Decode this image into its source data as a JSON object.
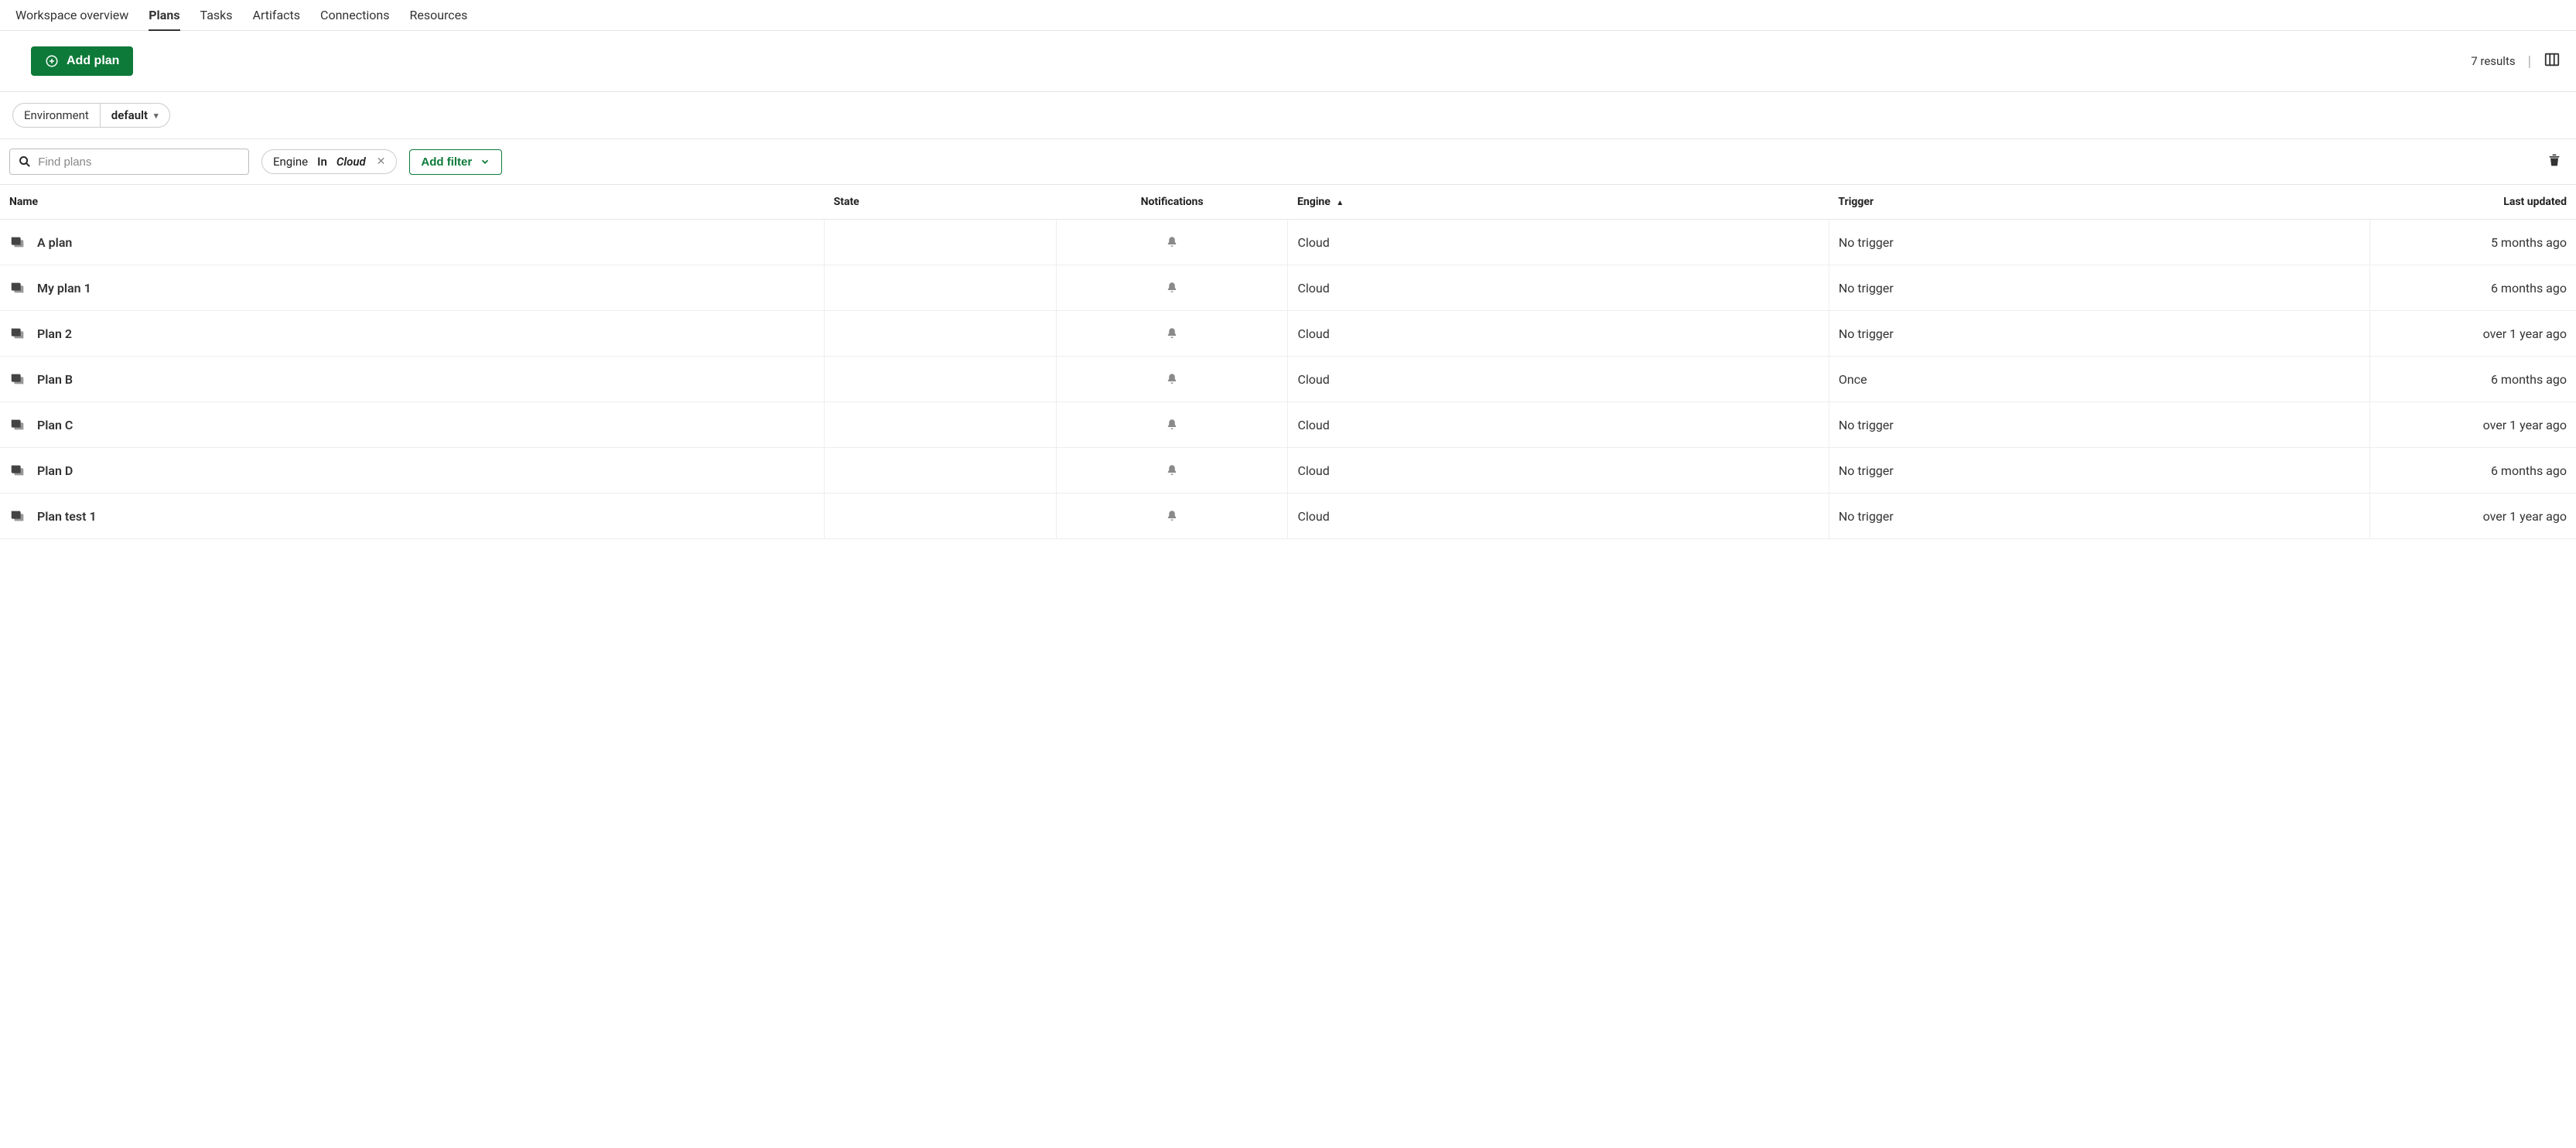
{
  "nav": {
    "items": [
      {
        "label": "Workspace overview",
        "active": false
      },
      {
        "label": "Plans",
        "active": true
      },
      {
        "label": "Tasks",
        "active": false
      },
      {
        "label": "Artifacts",
        "active": false
      },
      {
        "label": "Connections",
        "active": false
      },
      {
        "label": "Resources",
        "active": false
      }
    ]
  },
  "toolbar": {
    "add_plan_label": "Add plan",
    "results_label": "7 results"
  },
  "environment": {
    "label": "Environment",
    "value": "default"
  },
  "search": {
    "placeholder": "Find plans"
  },
  "filters": {
    "engine": {
      "field": "Engine",
      "op": "In",
      "value": "Cloud"
    },
    "add_filter_label": "Add filter"
  },
  "table": {
    "columns": {
      "name": "Name",
      "state": "State",
      "notifications": "Notifications",
      "engine": "Engine",
      "trigger": "Trigger",
      "last_updated": "Last updated"
    },
    "sort": {
      "column": "engine",
      "dir": "asc"
    },
    "rows": [
      {
        "name": "A plan",
        "state": "",
        "engine": "Cloud",
        "trigger": "No trigger",
        "last_updated": "5 months ago"
      },
      {
        "name": "My plan 1",
        "state": "",
        "engine": "Cloud",
        "trigger": "No trigger",
        "last_updated": "6 months ago"
      },
      {
        "name": "Plan 2",
        "state": "",
        "engine": "Cloud",
        "trigger": "No trigger",
        "last_updated": "over 1 year ago"
      },
      {
        "name": "Plan B",
        "state": "",
        "engine": "Cloud",
        "trigger": "Once",
        "last_updated": "6 months ago"
      },
      {
        "name": "Plan C",
        "state": "",
        "engine": "Cloud",
        "trigger": "No trigger",
        "last_updated": "over 1 year ago"
      },
      {
        "name": "Plan D",
        "state": "",
        "engine": "Cloud",
        "trigger": "No trigger",
        "last_updated": "6 months ago"
      },
      {
        "name": "Plan test 1",
        "state": "",
        "engine": "Cloud",
        "trigger": "No trigger",
        "last_updated": "over 1 year ago"
      }
    ]
  }
}
